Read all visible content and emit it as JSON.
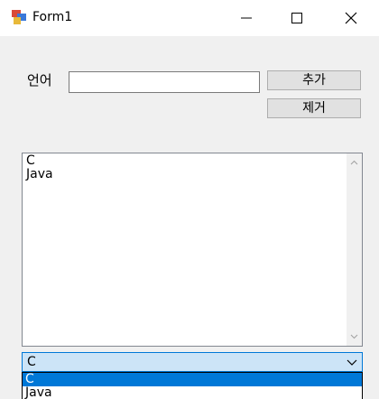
{
  "window": {
    "title": "Form1",
    "icon": "winforms-app-icon",
    "controls": [
      "minimize-icon",
      "maximize-icon",
      "close-icon"
    ]
  },
  "form": {
    "language_label": "언어",
    "language_input": {
      "value": "",
      "placeholder": ""
    },
    "add_button": "추가",
    "remove_button": "제거"
  },
  "listbox": {
    "items": [
      "C",
      "Java"
    ]
  },
  "combobox": {
    "selected": "C",
    "options": [
      "C",
      "Java"
    ],
    "highlighted_index": 0
  },
  "colors": {
    "accent": "#0078d7",
    "combo_bg": "#cce4f7",
    "window_bg": "#f0f0f0"
  }
}
